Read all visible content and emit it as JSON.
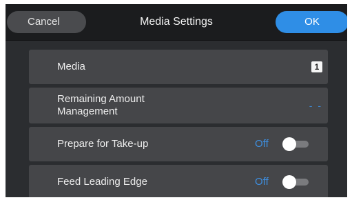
{
  "header": {
    "cancel_label": "Cancel",
    "title": "Media Settings",
    "ok_label": "OK"
  },
  "settings": [
    {
      "label": "Media",
      "value": "1",
      "value_icon": "media-number-badge"
    },
    {
      "label": "Remaining Amount\nManagement",
      "value": "- -"
    },
    {
      "label": "Prepare for Take-up",
      "state": "Off",
      "toggle_on": false
    },
    {
      "label": "Feed Leading Edge",
      "state": "Off",
      "toggle_on": false
    }
  ],
  "colors": {
    "accent": "#2f8ee6",
    "background": "#2b2d30",
    "row": "#454649",
    "header": "#1b1c1e"
  }
}
